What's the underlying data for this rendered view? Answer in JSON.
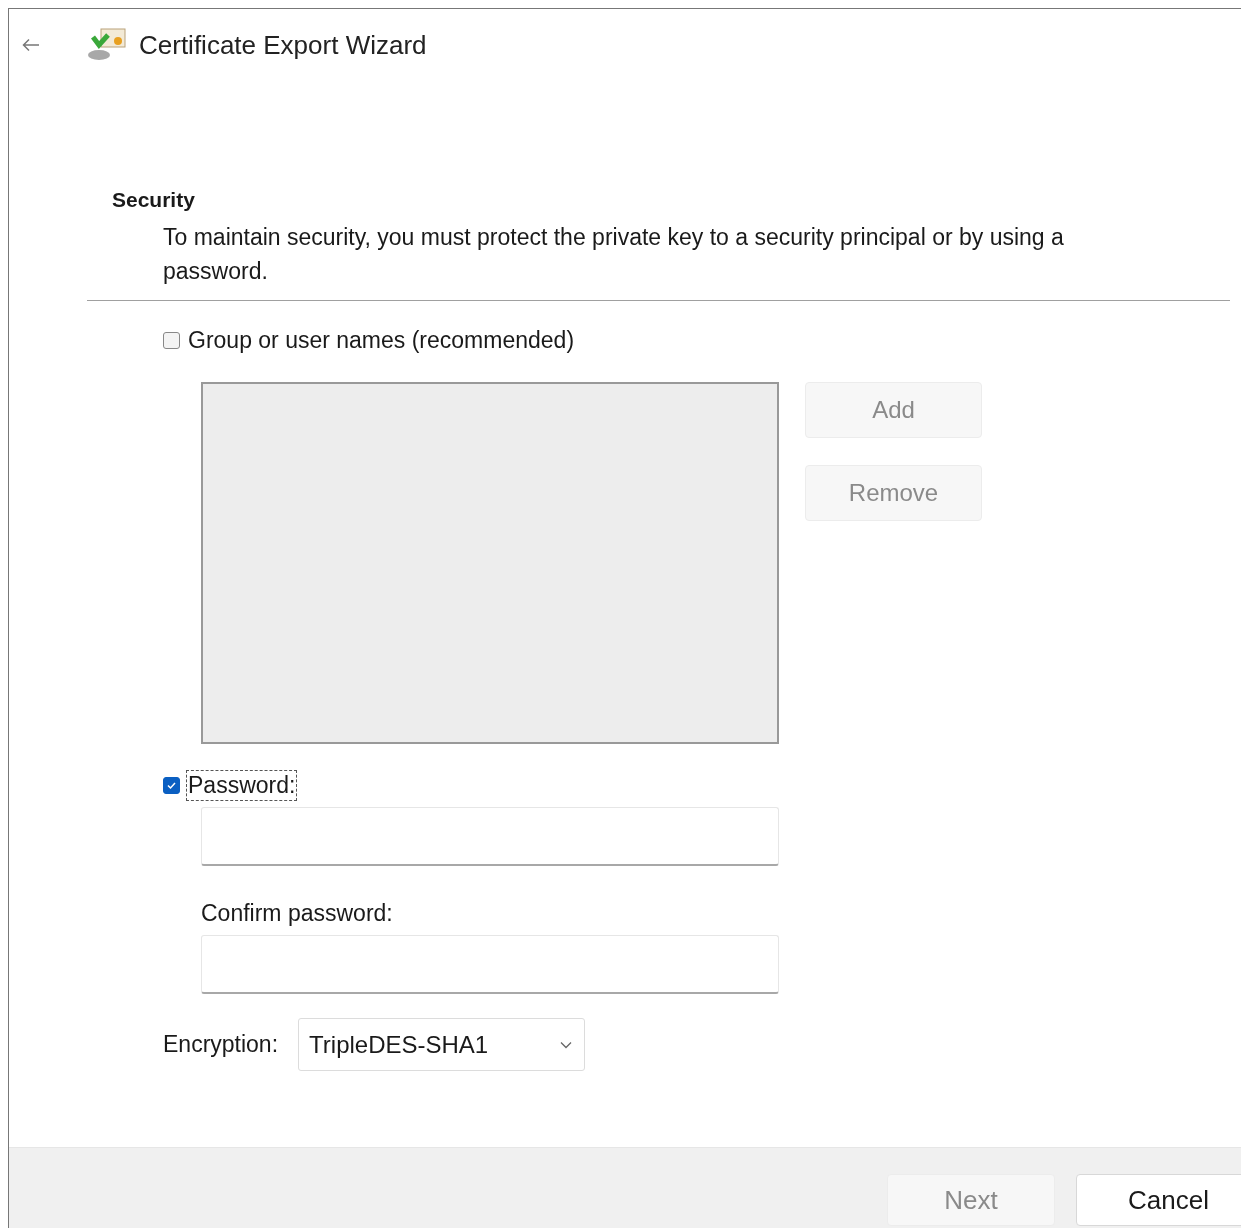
{
  "window": {
    "title": "Certificate Export Wizard"
  },
  "heading": "Security",
  "description": "To maintain security, you must protect the private key to a security principal or by using a password.",
  "group_option": {
    "label": "Group or user names (recommended)",
    "checked": false
  },
  "users_list": {
    "disabled": true
  },
  "list_buttons": [
    {
      "label": "Add",
      "disabled": true
    },
    {
      "label": "Remove",
      "disabled": true
    }
  ],
  "password_option": {
    "label": "Password:",
    "checked": true
  },
  "confirm_label": "Confirm password:",
  "encryption": {
    "label": "Encryption:",
    "value": "TripleDES-SHA1"
  },
  "footer_buttons": [
    {
      "label": "Next",
      "disabled": true
    },
    {
      "label": "Cancel",
      "disabled": false
    }
  ]
}
